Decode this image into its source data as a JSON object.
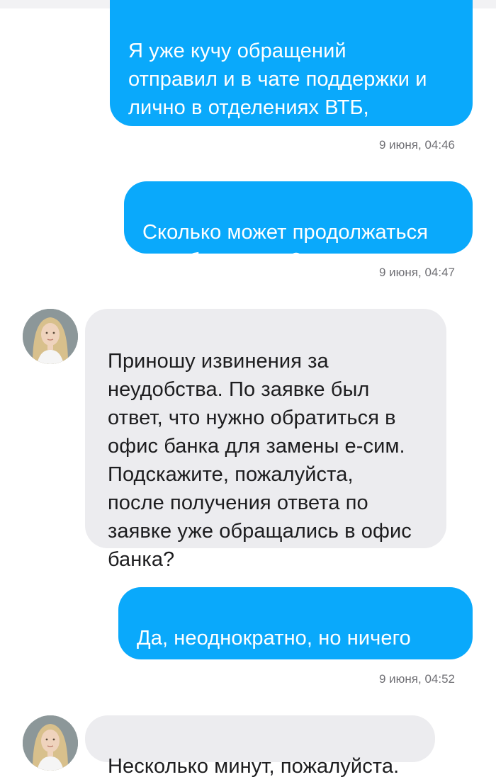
{
  "messages": [
    {
      "direction": "outgoing",
      "text": "Я уже кучу обращений\nотправил и в чате поддержки и\nлично в отделениях ВТБ,\nникакого результата",
      "time": "9 июня, 04:46"
    },
    {
      "direction": "outgoing",
      "text": "Сколько может продолжаться\nэтот беспредел?",
      "time": "9 июня, 04:47"
    },
    {
      "direction": "incoming",
      "avatar": "support-agent-avatar",
      "text": "Приношу извинения за\nнеудобства. По заявке был\nответ, что нужно обратиться в\nофис банка для замены е-сим.\nПодскажите, пожалуйста,\nпосле получения ответа по\nзаявке уже обращались в офис\nбанка?"
    },
    {
      "direction": "outgoing",
      "text": "Да, неоднократно, но ничего\nсделать в отделениях не могут",
      "time": "9 июня, 04:52"
    },
    {
      "direction": "incoming",
      "avatar": "support-agent-avatar",
      "text": "Несколько минут, пожалуйста."
    }
  ],
  "colors": {
    "outgoing_bubble": "#0aa9fb",
    "incoming_bubble": "#ececef",
    "timestamp": "#6f6f74"
  }
}
